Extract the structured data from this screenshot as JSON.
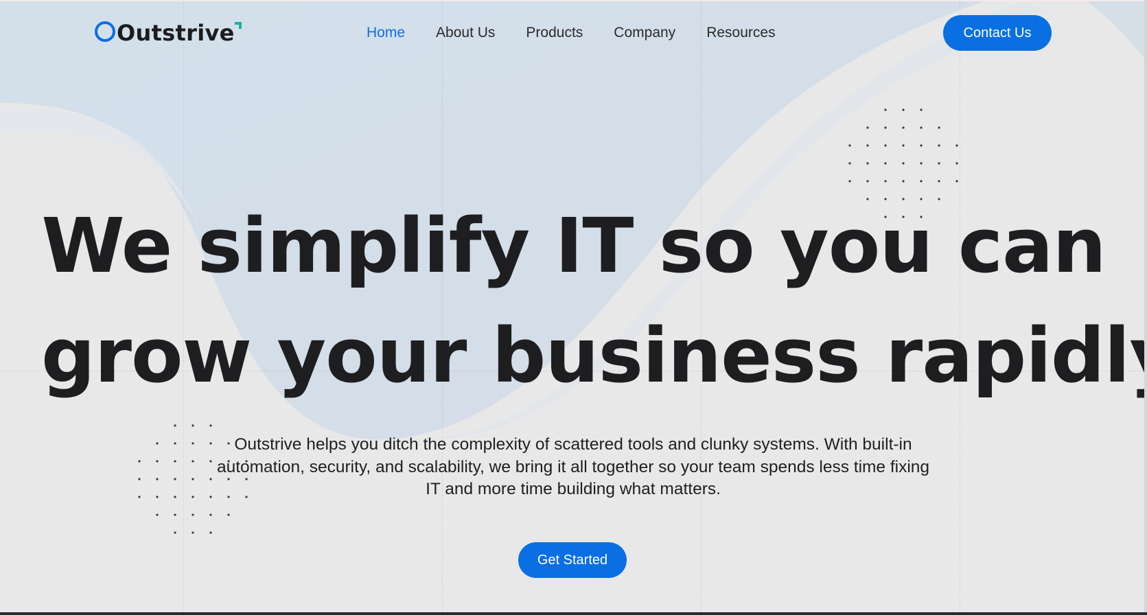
{
  "brand": {
    "name": "Outstrive",
    "primary_color": "#0a6fe3",
    "accent_color": "#11b59a"
  },
  "nav": {
    "items": [
      {
        "label": "Home",
        "active": true
      },
      {
        "label": "About Us",
        "active": false
      },
      {
        "label": "Products",
        "active": false
      },
      {
        "label": "Company",
        "active": false
      },
      {
        "label": "Resources",
        "active": false
      }
    ],
    "contact_label": "Contact Us"
  },
  "hero": {
    "title_line1": "We simplify IT so you can",
    "title_line2": "grow your business rapidly",
    "description": "Outstrive helps you ditch the complexity of scattered tools and clunky systems. With built-in automation, security, and scalability, we bring it all together so your team spends less time fixing IT and more time building what matters.",
    "cta_label": "Get Started"
  }
}
